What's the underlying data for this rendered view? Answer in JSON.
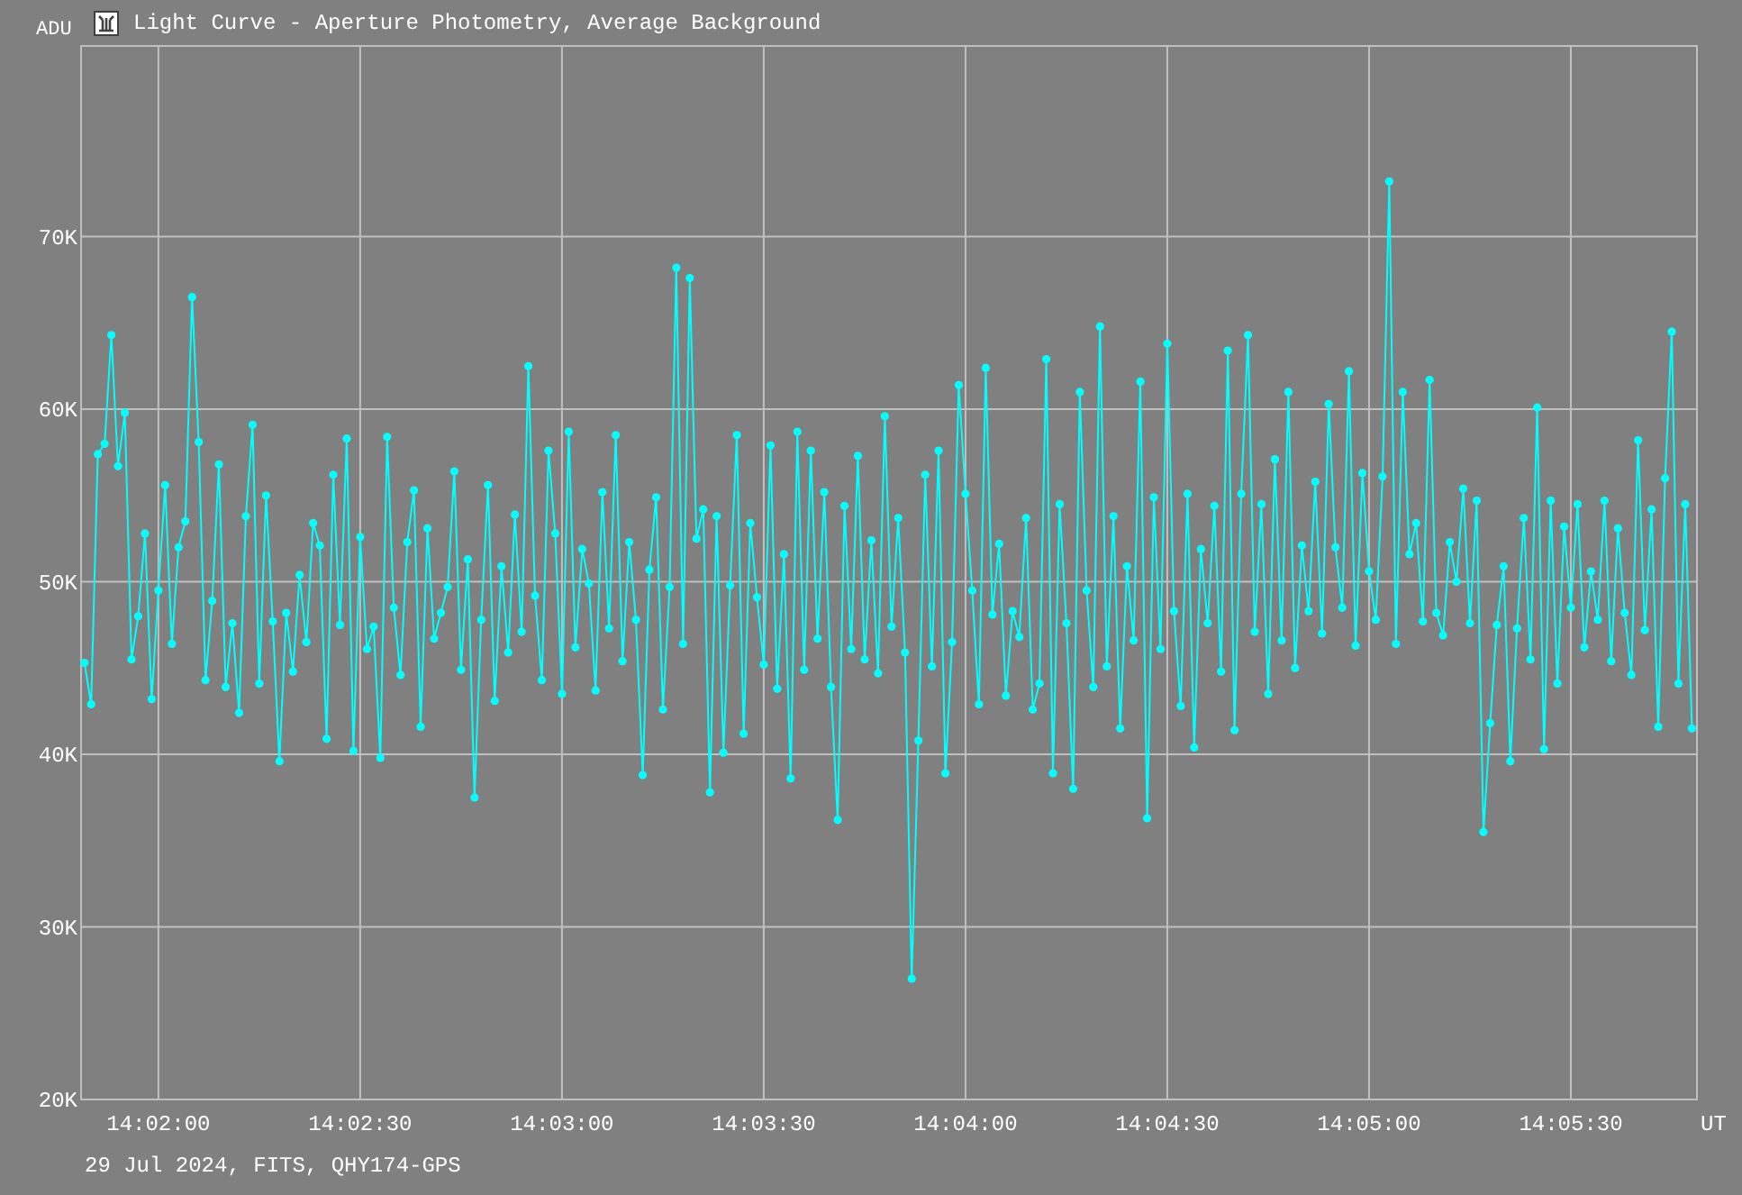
{
  "window": {
    "title": "Light Curve - Aperture Photometry, Average Background"
  },
  "chart": {
    "chart_data": {
      "type": "line",
      "grid": true,
      "xlabel": "UT",
      "categories": [
        null,
        null,
        null,
        null,
        null,
        null,
        null,
        null,
        null,
        null,
        null,
        "14:02:00",
        null,
        null,
        null,
        null,
        null,
        null,
        null,
        null,
        null,
        null,
        null,
        null,
        null,
        null,
        null,
        null,
        null,
        null,
        null,
        null,
        null,
        null,
        null,
        null,
        null,
        null,
        null,
        null,
        null,
        "14:02:30",
        null,
        null,
        null,
        null,
        null,
        null,
        null,
        null,
        null,
        null,
        null,
        null,
        null,
        null,
        null,
        null,
        null,
        null,
        null,
        null,
        null,
        null,
        null,
        null,
        null,
        null,
        null,
        null,
        null,
        "14:03:00",
        null,
        null,
        null,
        null,
        null,
        null,
        null,
        null,
        null,
        null,
        null,
        null,
        null,
        null,
        null,
        null,
        null,
        null,
        null,
        null,
        null,
        null,
        null,
        null,
        null,
        null,
        null,
        null,
        null,
        "14:03:30",
        null,
        null,
        null,
        null,
        null,
        null,
        null,
        null,
        null,
        null,
        null,
        null,
        null,
        null,
        null,
        null,
        null,
        null,
        null,
        null,
        null,
        null,
        null,
        null,
        null,
        null,
        null,
        null,
        null,
        "14:04:00",
        null,
        null,
        null,
        null,
        null,
        null,
        null,
        null,
        null,
        null,
        null,
        null,
        null,
        null,
        null,
        null,
        null,
        null,
        null,
        null,
        null,
        null,
        null,
        null,
        null,
        null,
        null,
        null,
        null,
        "14:04:30",
        null,
        null,
        null,
        null,
        null,
        null,
        null,
        null,
        null,
        null,
        null,
        null,
        null,
        null,
        null,
        null,
        null,
        null,
        null,
        null,
        null,
        null,
        null,
        null,
        null,
        null,
        null,
        null,
        null,
        "14:05:00",
        null,
        null,
        null,
        null,
        null,
        null,
        null,
        null,
        null,
        null,
        null,
        null,
        null,
        null,
        null,
        null,
        null,
        null,
        null,
        null,
        null,
        null,
        null,
        null,
        null,
        null,
        null,
        null,
        null,
        "14:05:30",
        null,
        null,
        null,
        null,
        null,
        null,
        null,
        null,
        null,
        null,
        null,
        null,
        null,
        null,
        null,
        null,
        null,
        null
      ],
      "ylabel": "ADU",
      "series": [
        {
          "color": "#00ffff",
          "marker": "circle",
          "values": [
            45.3,
            42.9,
            57.4,
            58,
            64.3,
            56.7,
            59.8,
            45.5,
            48,
            52.8,
            43.2,
            49.5,
            55.6,
            46.4,
            52,
            53.5,
            66.5,
            58.1,
            44.3,
            48.9,
            56.8,
            43.9,
            47.6,
            42.4,
            53.8,
            59.1,
            44.1,
            55,
            47.7,
            39.6,
            48.2,
            44.8,
            50.4,
            46.5,
            53.4,
            52.1,
            40.9,
            56.2,
            47.5,
            58.3,
            40.2,
            52.6,
            46.1,
            47.4,
            39.8,
            58.4,
            48.5,
            44.6,
            52.3,
            55.3,
            41.6,
            53.1,
            46.7,
            48.2,
            49.7,
            56.4,
            44.9,
            51.3,
            37.5,
            47.8,
            55.6,
            43.1,
            50.9,
            45.9,
            53.9,
            47.1,
            62.5,
            49.2,
            44.3,
            57.6,
            52.8,
            43.5,
            58.7,
            46.2,
            51.9,
            49.9,
            43.7,
            55.2,
            47.3,
            58.5,
            45.4,
            52.3,
            47.8,
            38.8,
            50.7,
            54.9,
            42.6,
            49.7,
            68.2,
            46.4,
            67.6,
            52.5,
            54.2,
            37.8,
            53.8,
            40.1,
            49.8,
            58.5,
            41.2,
            53.4,
            49.1,
            45.2,
            57.9,
            43.8,
            51.6,
            38.6,
            58.7,
            44.9,
            57.6,
            46.7,
            55.2,
            43.9,
            36.2,
            54.4,
            46.1,
            57.3,
            45.5,
            52.4,
            44.7,
            59.6,
            47.4,
            53.7,
            45.9,
            27,
            40.8,
            56.2,
            45.1,
            57.6,
            38.9,
            46.5,
            61.4,
            55.1,
            49.5,
            42.9,
            62.4,
            48.1,
            52.2,
            43.4,
            48.3,
            46.8,
            53.7,
            42.6,
            44.1,
            62.9,
            38.9,
            54.5,
            47.6,
            38,
            61,
            49.5,
            43.9,
            64.8,
            45.1,
            53.8,
            41.5,
            50.9,
            46.6,
            61.6,
            36.3,
            54.9,
            46.1,
            63.8,
            48.3,
            42.8,
            55.1,
            40.4,
            51.9,
            47.6,
            54.4,
            44.8,
            63.4,
            41.4,
            55.1,
            64.3,
            47.1,
            54.5,
            43.5,
            57.1,
            46.6,
            61,
            45,
            52.1,
            48.3,
            55.8,
            47,
            60.3,
            52,
            48.5,
            62.2,
            46.3,
            56.3,
            50.6,
            47.8,
            56.1,
            73.2,
            46.4,
            61,
            51.6,
            53.4,
            47.7,
            61.7,
            48.2,
            46.9,
            52.3,
            50,
            55.4,
            47.6,
            54.7,
            35.5,
            41.8,
            47.5,
            50.9,
            39.6,
            47.3,
            53.7,
            45.5,
            60.1,
            40.3,
            54.7,
            44.1,
            53.2,
            48.5,
            54.5,
            46.2,
            50.6,
            47.8,
            54.7,
            45.4,
            53.1,
            48.2,
            44.6,
            58.2,
            47.2,
            54.2,
            41.6,
            56,
            64.5,
            44.1,
            54.5,
            41.5
          ]
        }
      ],
      "ylim": [
        20,
        81
      ],
      "yticks": [
        {
          "value": 20,
          "label": "20K"
        },
        {
          "value": 30,
          "label": "30K"
        },
        {
          "value": 40,
          "label": "40K"
        },
        {
          "value": 50,
          "label": "50K"
        },
        {
          "value": 60,
          "label": "60K"
        },
        {
          "value": 70,
          "label": "70K"
        }
      ]
    }
  },
  "footer": "29 Jul 2024, FITS, QHY174-GPS"
}
